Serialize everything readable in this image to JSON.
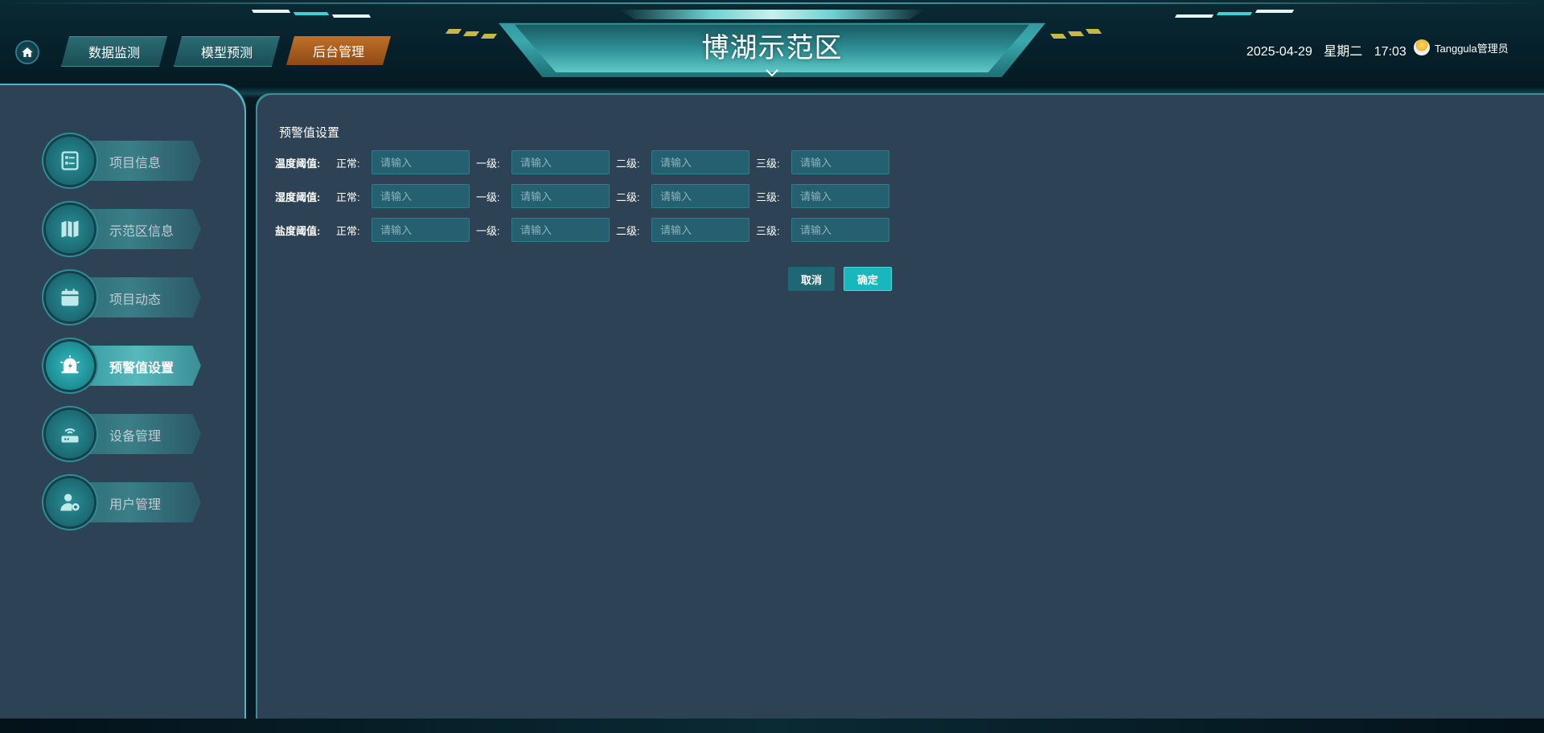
{
  "header": {
    "title": "博湖示范区",
    "tabs": [
      {
        "label": "数据监测",
        "active": false
      },
      {
        "label": "模型预测",
        "active": false
      },
      {
        "label": "后台管理",
        "active": true
      }
    ],
    "date": "2025-04-29",
    "weekday": "星期二",
    "time": "17:03",
    "user": "Tanggula管理员"
  },
  "sidebar": {
    "items": [
      {
        "label": "项目信息",
        "icon": "id-card-icon",
        "active": false
      },
      {
        "label": "示范区信息",
        "icon": "map-icon",
        "active": false
      },
      {
        "label": "项目动态",
        "icon": "calendar-icon",
        "active": false
      },
      {
        "label": "预警值设置",
        "icon": "alarm-bell-icon",
        "active": true
      },
      {
        "label": "设备管理",
        "icon": "router-icon",
        "active": false
      },
      {
        "label": "用户管理",
        "icon": "user-settings-icon",
        "active": false
      }
    ]
  },
  "form": {
    "title": "预警值设置",
    "levels": [
      "正常:",
      "一级:",
      "二级:",
      "三级:"
    ],
    "placeholder": "请输入",
    "rows": [
      {
        "label": "温度阈值:"
      },
      {
        "label": "湿度阈值:"
      },
      {
        "label": "盐度阈值:"
      }
    ],
    "cancel_label": "取消",
    "confirm_label": "确定"
  },
  "colors": {
    "active_tab": "#b8641f",
    "panel_bg": "#2d4254",
    "accent": "#1ab6be"
  }
}
